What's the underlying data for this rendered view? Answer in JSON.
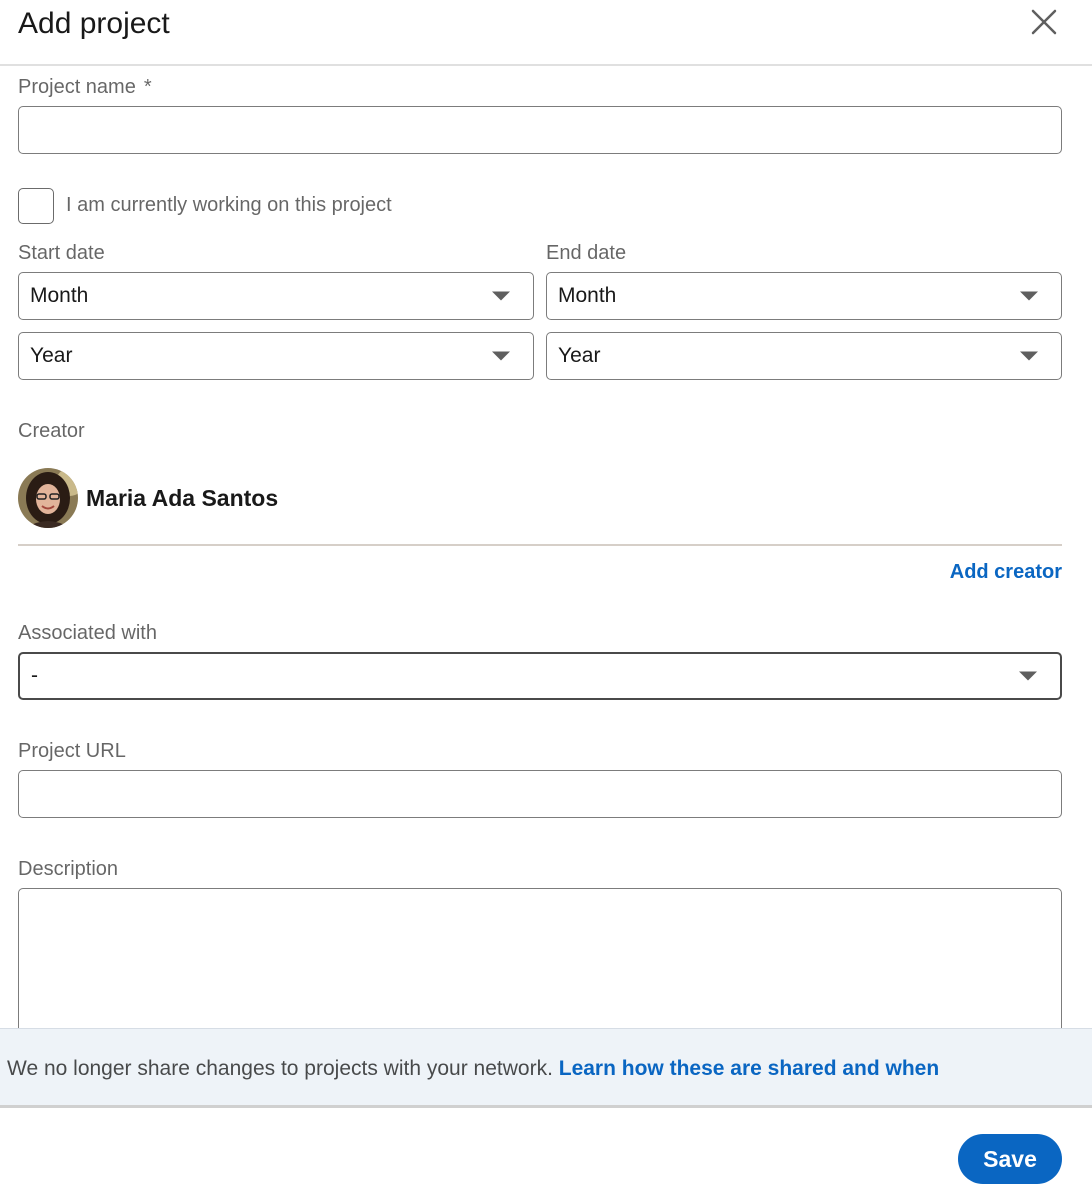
{
  "dialog": {
    "title": "Add project",
    "close_icon": "close-icon"
  },
  "form": {
    "project_name": {
      "label": "Project name",
      "required_marker": "*",
      "value": ""
    },
    "currently_working": {
      "label": "I am currently working on this project",
      "checked": false
    },
    "start_date": {
      "label": "Start date",
      "month": "Month",
      "year": "Year"
    },
    "end_date": {
      "label": "End date",
      "month": "Month",
      "year": "Year"
    },
    "creator": {
      "label": "Creator",
      "name": "Maria Ada Santos",
      "add_label": "Add creator"
    },
    "associated_with": {
      "label": "Associated with",
      "value": "-"
    },
    "project_url": {
      "label": "Project URL",
      "value": ""
    },
    "description": {
      "label": "Description",
      "value": ""
    }
  },
  "notice": {
    "text": "We no longer share changes to projects with your network.",
    "link": "Learn how these are shared and when"
  },
  "footer": {
    "save_label": "Save"
  },
  "colors": {
    "primary": "#0a66c2",
    "notice_bg": "#eef3f8",
    "text": "#191919",
    "muted": "#666666"
  }
}
